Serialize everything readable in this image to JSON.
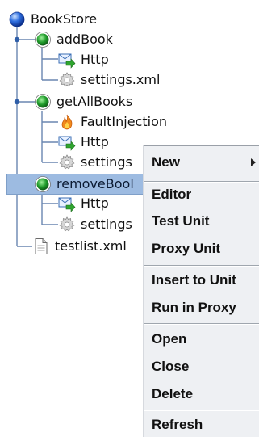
{
  "tree": {
    "root": {
      "label": "BookStore",
      "icon": "blue-ball-icon"
    },
    "nodes": [
      {
        "label": "addBook",
        "icon": "green-ball-icon"
      },
      {
        "label": "Http",
        "icon": "envelope-arrow-icon"
      },
      {
        "label": "settings.xml",
        "icon": "gear-icon"
      },
      {
        "label": "getAllBooks",
        "icon": "green-ball-icon"
      },
      {
        "label": "FaultInjection",
        "icon": "flame-icon"
      },
      {
        "label": "Http",
        "icon": "envelope-arrow-icon"
      },
      {
        "label": "settings",
        "icon": "gear-icon"
      },
      {
        "label": "removeBool",
        "icon": "green-ball-icon",
        "selected": true
      },
      {
        "label": "Http",
        "icon": "envelope-arrow-icon"
      },
      {
        "label": "settings",
        "icon": "gear-icon"
      },
      {
        "label": "testlist.xml",
        "icon": "document-icon"
      }
    ],
    "colors": {
      "selection": "#9dbbe1",
      "connector": "#6a86b0"
    }
  },
  "context_menu": {
    "groups": [
      [
        {
          "label": "New",
          "has_submenu": true
        }
      ],
      [
        {
          "label": "Editor"
        },
        {
          "label": "Test Unit"
        },
        {
          "label": "Proxy Unit"
        }
      ],
      [
        {
          "label": "Insert to Unit"
        },
        {
          "label": "Run in Proxy"
        }
      ],
      [
        {
          "label": "Open"
        },
        {
          "label": "Close"
        },
        {
          "label": "Delete"
        }
      ],
      [
        {
          "label": "Refresh"
        }
      ]
    ]
  }
}
